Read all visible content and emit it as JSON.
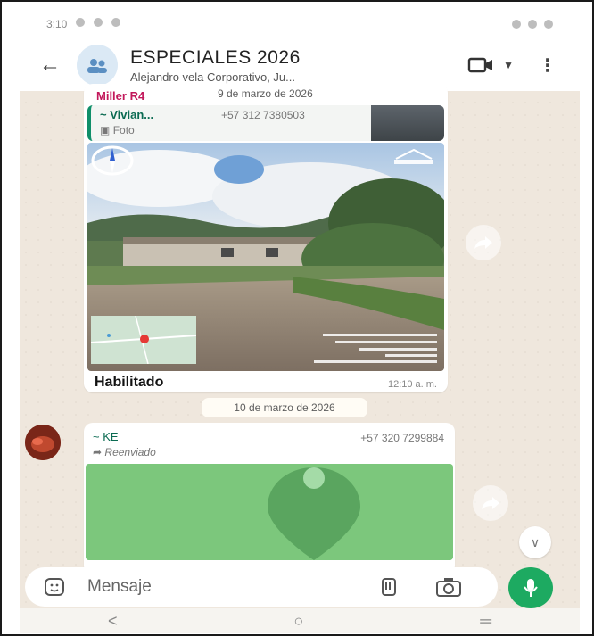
{
  "status_bar": {
    "time": "3:10"
  },
  "header": {
    "title": "ESPECIALES 2026",
    "subtitle": "Alejandro vela Corporativo, Ju..."
  },
  "messages": {
    "first": {
      "sender": "Miller R4",
      "date": "9 de marzo de 2026",
      "quote_name": "~ Vivian...",
      "quote_phone": "+57 312 7380503",
      "quote_type": "Foto",
      "caption": "Habilitado",
      "time": "12:10 a. m."
    },
    "date_separator": "10 de marzo de 2026",
    "second": {
      "sender": "~ KE",
      "phone": "+57 320 7299884",
      "forwarded_label": "Reenviado"
    }
  },
  "composer": {
    "placeholder": "Mensaje"
  },
  "navbar": {
    "back": "<",
    "home": "○",
    "recents": "═"
  },
  "colors": {
    "accent_green": "#1daa61",
    "chat_background": "#efe7dd",
    "sender_pink": "#c2185b",
    "quote_green": "#0f8f6a",
    "map_green": "#7cc77c"
  },
  "icons": [
    "back-arrow-icon",
    "group-avatar-icon",
    "video-call-icon",
    "chevron-down-icon",
    "more-options-icon",
    "photo-icon",
    "forward-icon",
    "scroll-down-icon",
    "emoji-sticker-icon",
    "attach-icon",
    "camera-icon",
    "mic-icon"
  ]
}
